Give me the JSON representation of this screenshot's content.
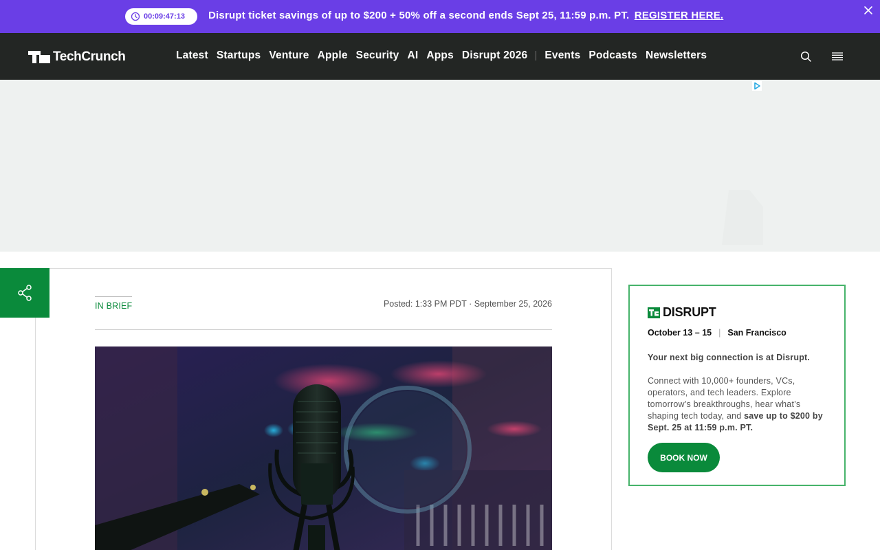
{
  "promo_banner": {
    "countdown": "00:09:47:13",
    "text": "Disrupt ticket savings of up to $200 + 50% off a second ends Sept 25, 11:59 p.m. PT.",
    "link_label": "REGISTER HERE.",
    "background_color": "#6a3ee6"
  },
  "nav": {
    "logo": "TechCrunch",
    "items_primary": [
      "Latest",
      "Startups",
      "Venture",
      "Apple",
      "Security",
      "AI",
      "Apps",
      "Disrupt 2026"
    ],
    "items_secondary": [
      "Events",
      "Podcasts",
      "Newsletters"
    ],
    "background_color": "#232624"
  },
  "article": {
    "category": "IN BRIEF",
    "posted": "Posted: 1:33 PM PDT · September 25, 2026",
    "accent_color": "#0a8a3b"
  },
  "sidebar_card": {
    "logo": "DISRUPT",
    "dates": "October 13 – 15",
    "location": "San Francisco",
    "tagline": "Your next big connection is at Disrupt.",
    "body": "Connect with 10,000+ founders, VCs, operators, and tech leaders. Explore tomorrow’s breakthroughs, hear what’s shaping tech today, and ",
    "body_bold": "save up to $200 by Sept. 25 at 11:59 p.m. PT.",
    "button_label": "BOOK NOW",
    "border_color": "#46b36a"
  }
}
